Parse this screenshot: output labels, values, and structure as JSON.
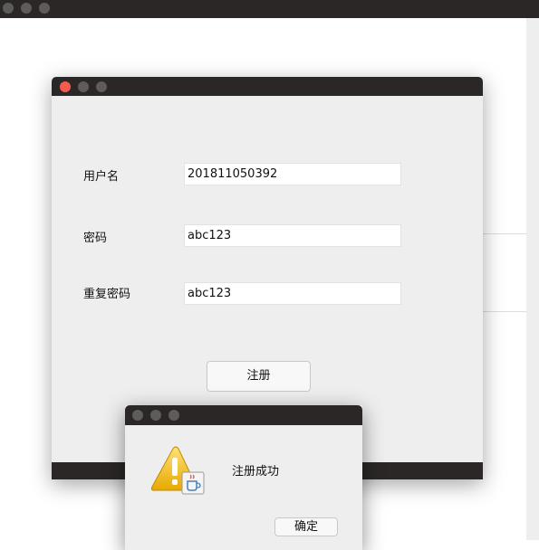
{
  "register_form": {
    "username_label": "用户名",
    "username_value": "201811050392",
    "password_label": "密码",
    "password_value": "abc123",
    "confirm_label": "重复密码",
    "confirm_value": "abc123",
    "submit_label": "注册"
  },
  "dialog": {
    "message": "注册成功",
    "ok_label": "确定",
    "icon": "warning-java-icon"
  },
  "colors": {
    "titlebar": "#2b2727",
    "window_bg": "#eeeeee",
    "close_button": "#f25a52",
    "inactive_button": "#5e5b5b"
  }
}
